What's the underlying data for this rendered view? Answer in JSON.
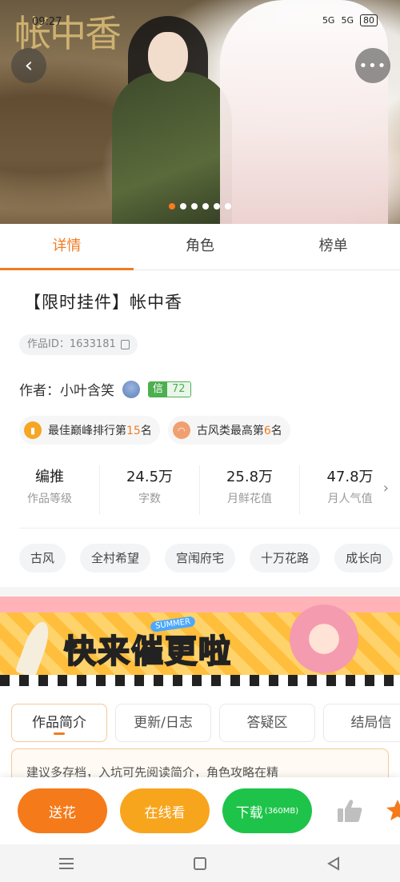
{
  "status_bar": {
    "time": "09:27",
    "icons": [
      "5G",
      "5G",
      "80"
    ]
  },
  "hero": {
    "calligraphy_title": "帐中香",
    "dots_count": 6,
    "active_dot": 0
  },
  "tabs": [
    {
      "label": "详情",
      "active": true
    },
    {
      "label": "角色",
      "active": false
    },
    {
      "label": "榜单",
      "active": false
    }
  ],
  "work": {
    "title": "【限时挂件】帐中香",
    "id_label": "作品ID：1633181",
    "author_label": "作者：小叶含笑",
    "credit_badge": {
      "prefix": "信",
      "value": "72"
    }
  },
  "rankings": [
    {
      "prefix": "最佳巅峰排行第",
      "highlight": "15",
      "suffix": "名",
      "icon_color": "#f5a623"
    },
    {
      "prefix": "古风类最高第",
      "highlight": "6",
      "suffix": "名",
      "icon_color": "#f0a070"
    }
  ],
  "stats": [
    {
      "value": "编推",
      "label": "作品等级"
    },
    {
      "value": "24.5万",
      "label": "字数"
    },
    {
      "value": "25.8万",
      "label": "月鲜花值"
    },
    {
      "value": "47.8万",
      "label": "月人气值"
    }
  ],
  "tags": [
    "古风",
    "全村希望",
    "宫闱府宅",
    "十万花路",
    "成长向"
  ],
  "banner": {
    "text": "快来催更啦",
    "badge": "SUMMER"
  },
  "sub_tabs": [
    {
      "label": "作品简介",
      "active": true
    },
    {
      "label": "更新/日志",
      "active": false
    },
    {
      "label": "答疑区",
      "active": false
    },
    {
      "label": "结局信",
      "active": false
    }
  ],
  "intro_text": "建议多存档，入坑可先阅读简介，角色攻略在精",
  "bottom_actions": {
    "flower": "送花",
    "read": "在线看",
    "download": "下载",
    "download_size": "(360MB)"
  },
  "colors": {
    "accent": "#f07c22",
    "green": "#1ec34a",
    "yellow": "#f8a51e"
  }
}
